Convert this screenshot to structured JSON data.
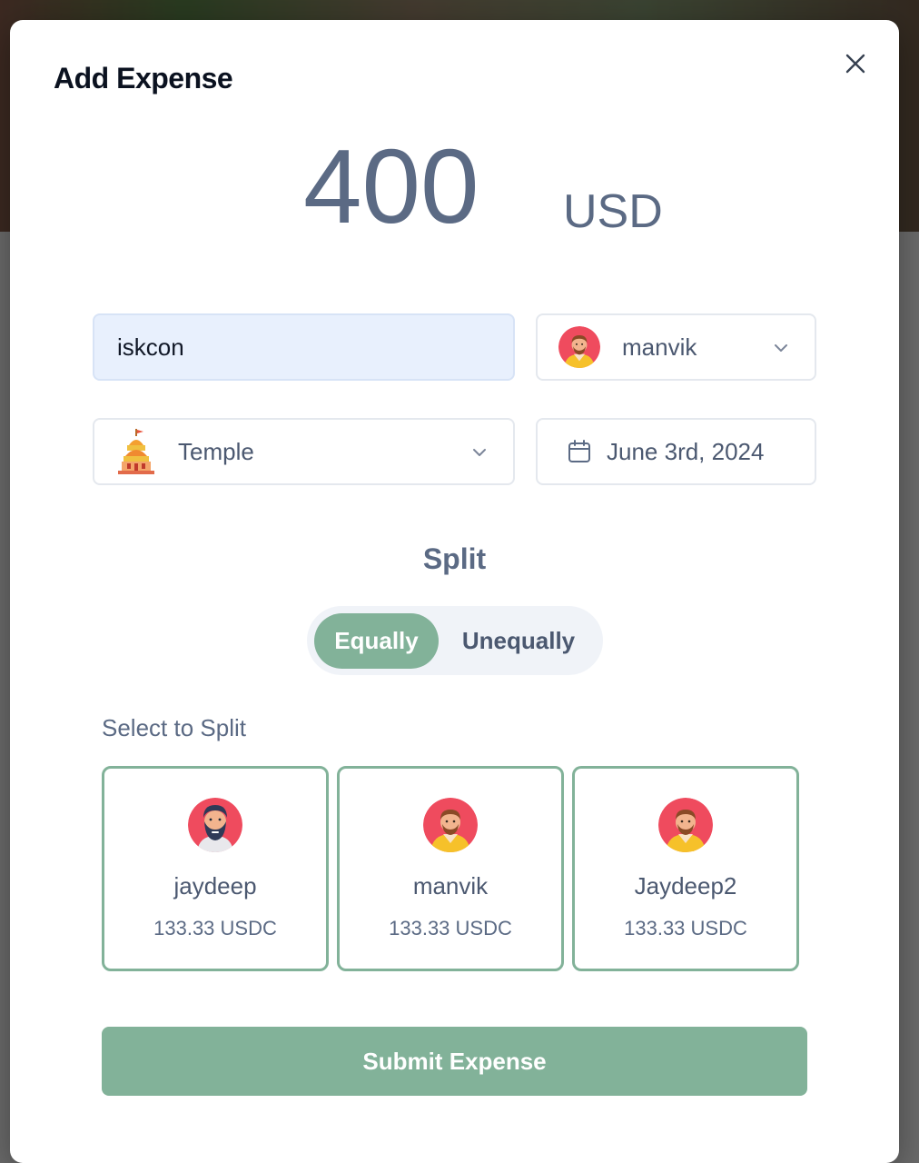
{
  "modal": {
    "title": "Add Expense"
  },
  "amount": {
    "value": "400",
    "currency": "USD"
  },
  "description": {
    "value": "iskcon"
  },
  "payer": {
    "name": "manvik",
    "avatar": "bearded-man-yellow-hoodie-avatar"
  },
  "category": {
    "label": "Temple",
    "icon": "temple-icon"
  },
  "date": {
    "label": "June 3rd, 2024",
    "icon": "calendar-icon"
  },
  "split": {
    "heading": "Split",
    "options": [
      "Equally",
      "Unequally"
    ],
    "selected": "Equally",
    "select_label": "Select to Split",
    "members": [
      {
        "name": "jaydeep",
        "amount": "133.33 USDC",
        "avatar": "bearded-man-avatar"
      },
      {
        "name": "manvik",
        "amount": "133.33 USDC",
        "avatar": "bearded-man-yellow-hoodie-avatar"
      },
      {
        "name": "Jaydeep2",
        "amount": "133.33 USDC",
        "avatar": "bearded-man-yellow-hoodie-avatar"
      }
    ]
  },
  "submit": {
    "label": "Submit Expense"
  },
  "colors": {
    "accent": "#82b299",
    "text_muted": "#5b6a84",
    "input_highlight": "#e8f0fd"
  }
}
